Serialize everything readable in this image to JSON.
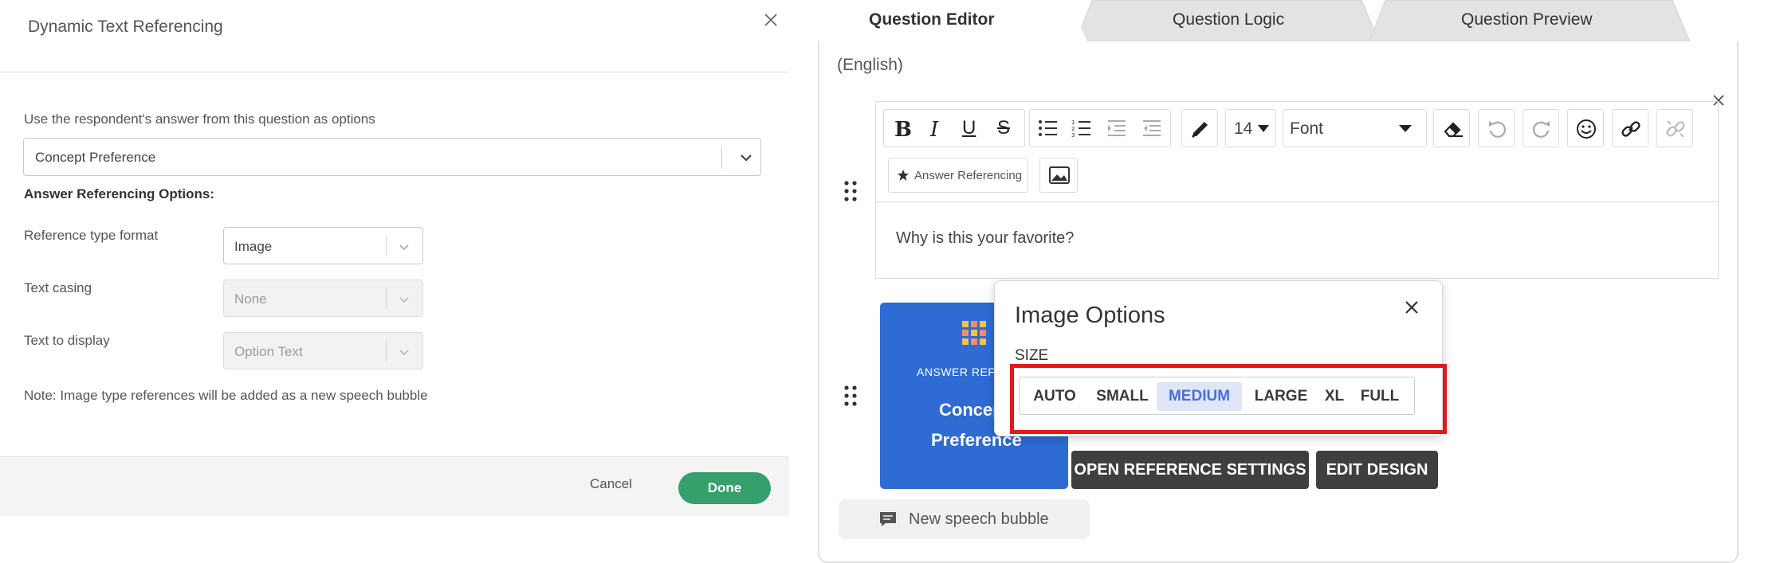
{
  "dialog": {
    "title": "Dynamic Text Referencing",
    "question_label": "Use the respondent's answer from this question as options",
    "question_value": "Concept Preference",
    "options_heading": "Answer Referencing Options:",
    "fields": [
      {
        "label": "Reference type format",
        "value": "Image",
        "disabled": false
      },
      {
        "label": "Text casing",
        "value": "None",
        "disabled": true
      },
      {
        "label": "Text to display",
        "value": "Option Text",
        "disabled": true
      }
    ],
    "note": "Note: Image type references will be added as a new speech bubble",
    "cancel_label": "Cancel",
    "done_label": "Done"
  },
  "tabs": [
    {
      "label": "Question Editor",
      "active": true
    },
    {
      "label": "Question Logic",
      "active": false
    },
    {
      "label": "Question Preview",
      "active": false
    }
  ],
  "editor": {
    "language": "(English)",
    "font_size": "14",
    "font": "Font",
    "answer_referencing_label": "Answer Referencing",
    "text": "Why is this your favorite?"
  },
  "image_card": {
    "label": "ANSWER REFERE",
    "name_line1": "Concep",
    "name_line2": "Preference"
  },
  "image_options": {
    "title": "Image Options",
    "size_label": "SIZE",
    "sizes": [
      "AUTO",
      "SMALL",
      "MEDIUM",
      "LARGE",
      "XL",
      "FULL"
    ],
    "selected_size": "MEDIUM"
  },
  "buttons": {
    "open_reference_settings": "OPEN REFERENCE SETTINGS",
    "edit_design": "EDIT DESIGN",
    "new_speech_bubble": "New speech bubble"
  },
  "colors": {
    "done_green": "#35a06b",
    "card_blue": "#2e6bd3",
    "highlight_red": "#e21a1a",
    "selected_size_bg": "#dfe6f8",
    "dark_button": "#3f3f3f"
  }
}
